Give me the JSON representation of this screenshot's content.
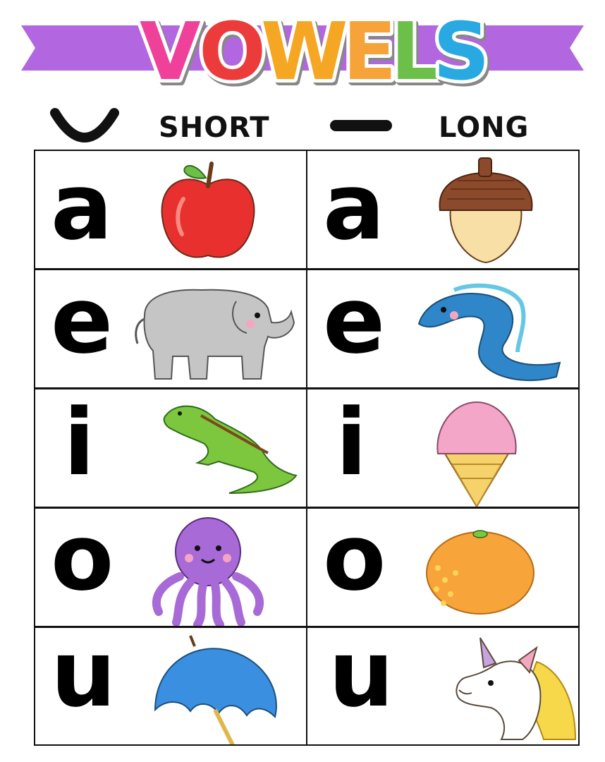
{
  "title": "VOWELS",
  "title_letters": [
    {
      "char": "V",
      "color": "#f0419a"
    },
    {
      "char": "O",
      "color": "#ec3b3b"
    },
    {
      "char": "W",
      "color": "#f5a623"
    },
    {
      "char": "E",
      "color": "#f6a33a"
    },
    {
      "char": "L",
      "color": "#6cc04a"
    },
    {
      "char": "S",
      "color": "#29a9e1"
    }
  ],
  "banner_color": "#b266e0",
  "columns": [
    {
      "label": "SHORT",
      "mark_icon": "breve-icon"
    },
    {
      "label": "LONG",
      "mark_icon": "macron-icon"
    }
  ],
  "rows": [
    {
      "short": {
        "letter": "a",
        "picture": "apple-icon"
      },
      "long": {
        "letter": "a",
        "picture": "acorn-icon"
      }
    },
    {
      "short": {
        "letter": "e",
        "picture": "elephant-icon"
      },
      "long": {
        "letter": "e",
        "picture": "eel-icon"
      }
    },
    {
      "short": {
        "letter": "i",
        "picture": "iguana-icon"
      },
      "long": {
        "letter": "i",
        "picture": "ice-cream-icon"
      }
    },
    {
      "short": {
        "letter": "o",
        "picture": "octopus-icon"
      },
      "long": {
        "letter": "o",
        "picture": "orange-icon"
      }
    },
    {
      "short": {
        "letter": "u",
        "picture": "umbrella-icon"
      },
      "long": {
        "letter": "u",
        "picture": "unicorn-icon"
      }
    }
  ]
}
